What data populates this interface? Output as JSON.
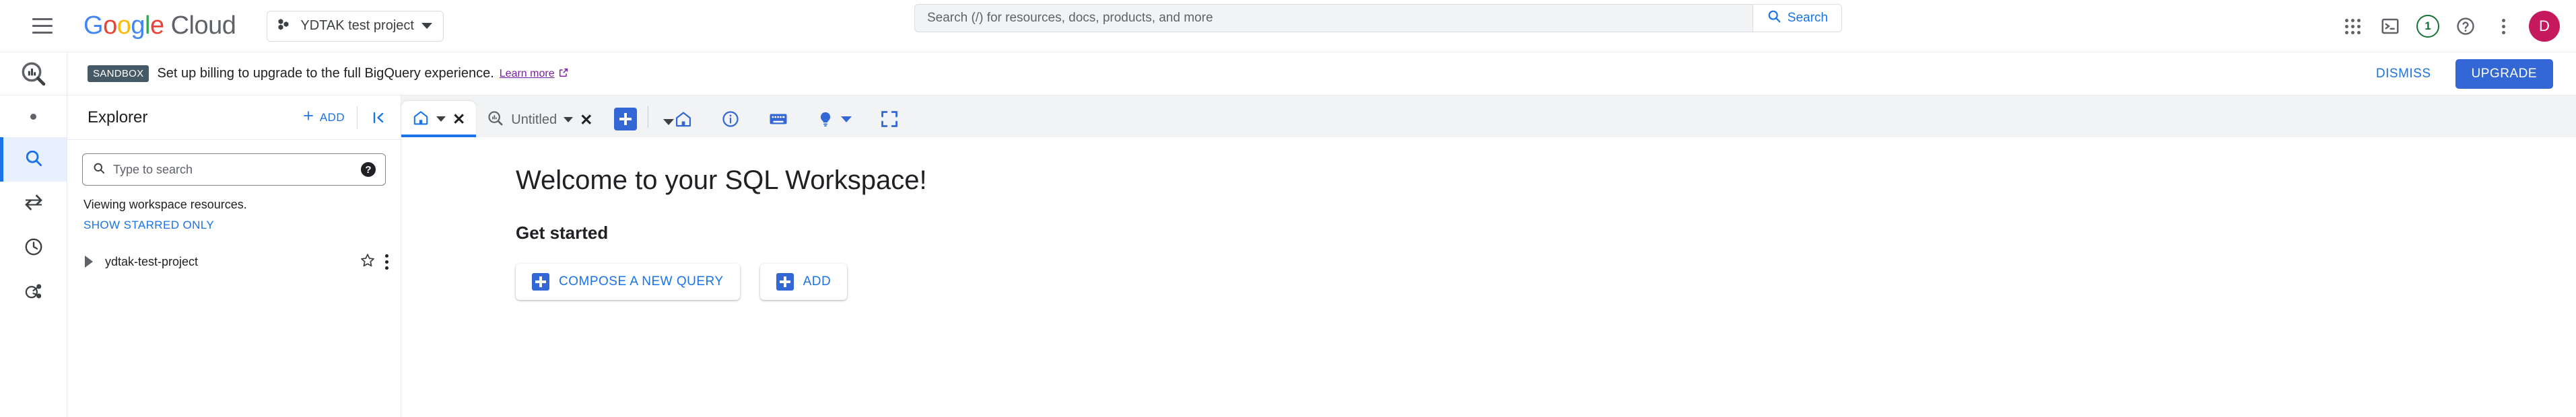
{
  "topbar": {
    "menu_icon": "hamburger-icon",
    "logo": {
      "google": "Google",
      "cloud": "Cloud"
    },
    "project_selector": {
      "label": "YDTAK test project",
      "icon": "cloud-project-icon"
    },
    "search": {
      "placeholder": "Search (/) for resources, docs, products, and more",
      "value": "",
      "button_label": "Search",
      "icon": "search-icon"
    },
    "icons": {
      "apps": "apps-grid-icon",
      "cloud_shell": "cloud-shell-icon",
      "notifications_count": "1",
      "help": "help-icon",
      "more": "more-vert-icon"
    },
    "avatar_letter": "D"
  },
  "banner": {
    "badge": "SANDBOX",
    "message": "Set up billing to upgrade to the full BigQuery experience.",
    "link_text": "Learn more",
    "link_icon": "open-in-new-icon",
    "dismiss_label": "DISMISS",
    "upgrade_label": "UPGRADE"
  },
  "rail": {
    "logo_icon": "bigquery-logo-icon",
    "items": [
      {
        "icon": "dot-icon",
        "name": "studio",
        "active": false
      },
      {
        "icon": "search-icon",
        "name": "explorer",
        "active": true
      },
      {
        "icon": "transfer-icon",
        "name": "data-transfers",
        "active": false
      },
      {
        "icon": "history-icon",
        "name": "job-history",
        "active": false
      },
      {
        "icon": "data-share-icon",
        "name": "analytics-hub",
        "active": false
      }
    ]
  },
  "explorer": {
    "title": "Explorer",
    "add_label": "ADD",
    "add_icon": "plus-icon",
    "collapse_icon": "collapse-left-icon",
    "search": {
      "placeholder": "Type to search",
      "value": "",
      "icon": "search-icon",
      "help_icon": "help-icon"
    },
    "viewing_text": "Viewing workspace resources.",
    "show_starred_label": "SHOW STARRED ONLY",
    "tree": [
      {
        "label": "ydtak-test-project",
        "expand_icon": "chevron-right-icon",
        "star_icon": "star-outline-icon",
        "menu_icon": "more-vert-icon"
      }
    ]
  },
  "tabbar": {
    "tabs": [
      {
        "label": "",
        "icon": "home-icon",
        "active": true,
        "close_icon": "close-icon",
        "caret_icon": "chevron-down-icon"
      },
      {
        "label": "Untitled",
        "icon": "query-icon",
        "active": false,
        "close_icon": "close-icon",
        "caret_icon": "chevron-down-icon"
      }
    ],
    "new_tab_icon": "plus-icon",
    "new_tab_caret": "chevron-down-icon",
    "right_icons": [
      {
        "name": "home-icon"
      },
      {
        "name": "info-icon"
      },
      {
        "name": "keyboard-icon"
      },
      {
        "name": "lightbulb-icon",
        "has_caret": true
      },
      {
        "name": "fullscreen-icon"
      }
    ]
  },
  "main": {
    "welcome_title": "Welcome to your SQL Workspace!",
    "get_started_title": "Get started",
    "buttons": [
      {
        "label": "COMPOSE A NEW QUERY",
        "icon": "plus-square-icon"
      },
      {
        "label": "ADD",
        "icon": "plus-square-icon"
      }
    ]
  },
  "colors": {
    "accent_blue": "#1a73e8",
    "button_blue": "#3367d6",
    "link_purple": "#7b1fa2",
    "badge_green": "#137333",
    "avatar_pink": "#c5185d",
    "sandbox_slate": "#455a64"
  }
}
